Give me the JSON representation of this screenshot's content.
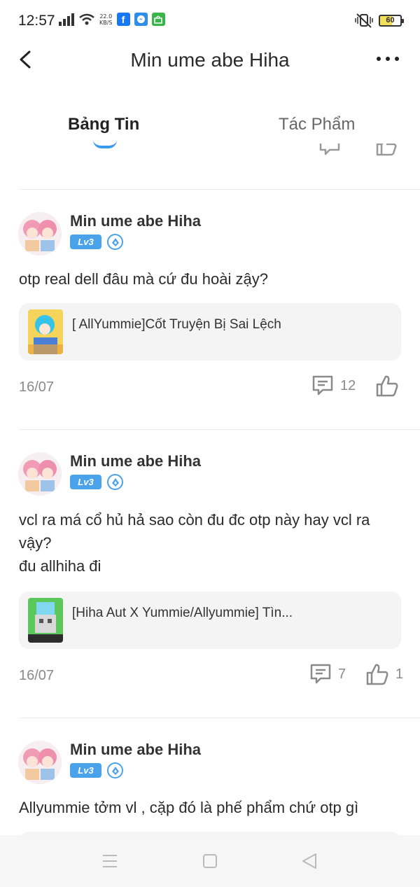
{
  "status_bar": {
    "time": "12:57",
    "net_speed_value": "22.0",
    "net_speed_unit": "KB/S",
    "battery": "60"
  },
  "header": {
    "title": "Min ume abe Hiha"
  },
  "tabs": [
    {
      "label": "Bảng Tin",
      "active": true
    },
    {
      "label": "Tác Phẩm",
      "active": false
    }
  ],
  "posts": [
    {
      "author": "Min ume abe Hiha",
      "level": "Lv3",
      "text_lines": [
        "otp real dell đâu mà cứ đu hoài zậy?"
      ],
      "card_title": "[ AllYummie]Cốt Truyện Bị Sai Lệch",
      "date": "16/07",
      "comments": "12",
      "likes": ""
    },
    {
      "author": "Min ume abe Hiha",
      "level": "Lv3",
      "text_lines": [
        "vcl ra má cổ hủ hả sao còn đu đc otp này hay vcl ra",
        "vậy?",
        "đu allhiha đi"
      ],
      "card_title": "[Hiha Aut X Yummie/Allyummie] Tìn...",
      "date": "16/07",
      "comments": "7",
      "likes": "1"
    },
    {
      "author": "Min ume abe Hiha",
      "level": "Lv3",
      "text_lines": [
        "Allyummie tởm vl , cặp đó là phế phẩm chứ otp gì"
      ]
    }
  ],
  "colors": {
    "accent": "#3a9af0",
    "level_badge": "#4aa3ea",
    "muted_text": "#8a8a8a",
    "card_bg": "#f4f4f5"
  },
  "icons": [
    "back-arrow-icon",
    "more-icon",
    "comment-icon",
    "like-icon",
    "verified-mark-icon",
    "menu-icon",
    "home-icon",
    "back-icon"
  ]
}
